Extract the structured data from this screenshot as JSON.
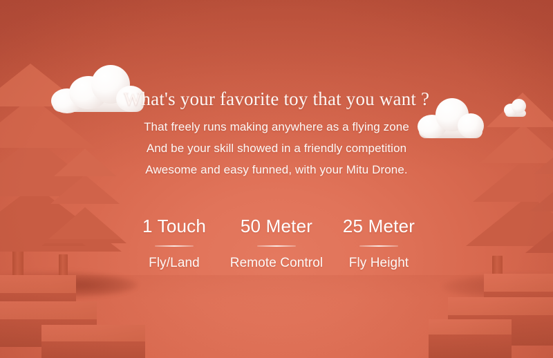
{
  "scene": {
    "background_color": "#d96a50",
    "background_color_dark": "#c1553f",
    "background_color_light": "#e4795f",
    "cloud_color": "#ffffff",
    "text_color": "#ffffff"
  },
  "copy": {
    "headline": "What's your favorite toy that you want ?",
    "lines": [
      "That freely runs making anywhere as a flying zone",
      "And be your skill showed in a friendly competition",
      "Awesome and easy funned, with your Mitu Drone."
    ]
  },
  "stats": [
    {
      "value": "1 Touch",
      "label": "Fly/Land"
    },
    {
      "value": "50 Meter",
      "label": "Remote Control"
    },
    {
      "value": "25 Meter",
      "label": "Fly Height"
    }
  ],
  "decor": {
    "trees": [
      "tree-left-large",
      "tree-left-small",
      "tree-right-large",
      "tree-right-edge"
    ],
    "clouds": [
      "cloud-left",
      "cloud-right",
      "cloud-right-small"
    ],
    "blocks": [
      "step-block-left",
      "step-block-right"
    ]
  }
}
